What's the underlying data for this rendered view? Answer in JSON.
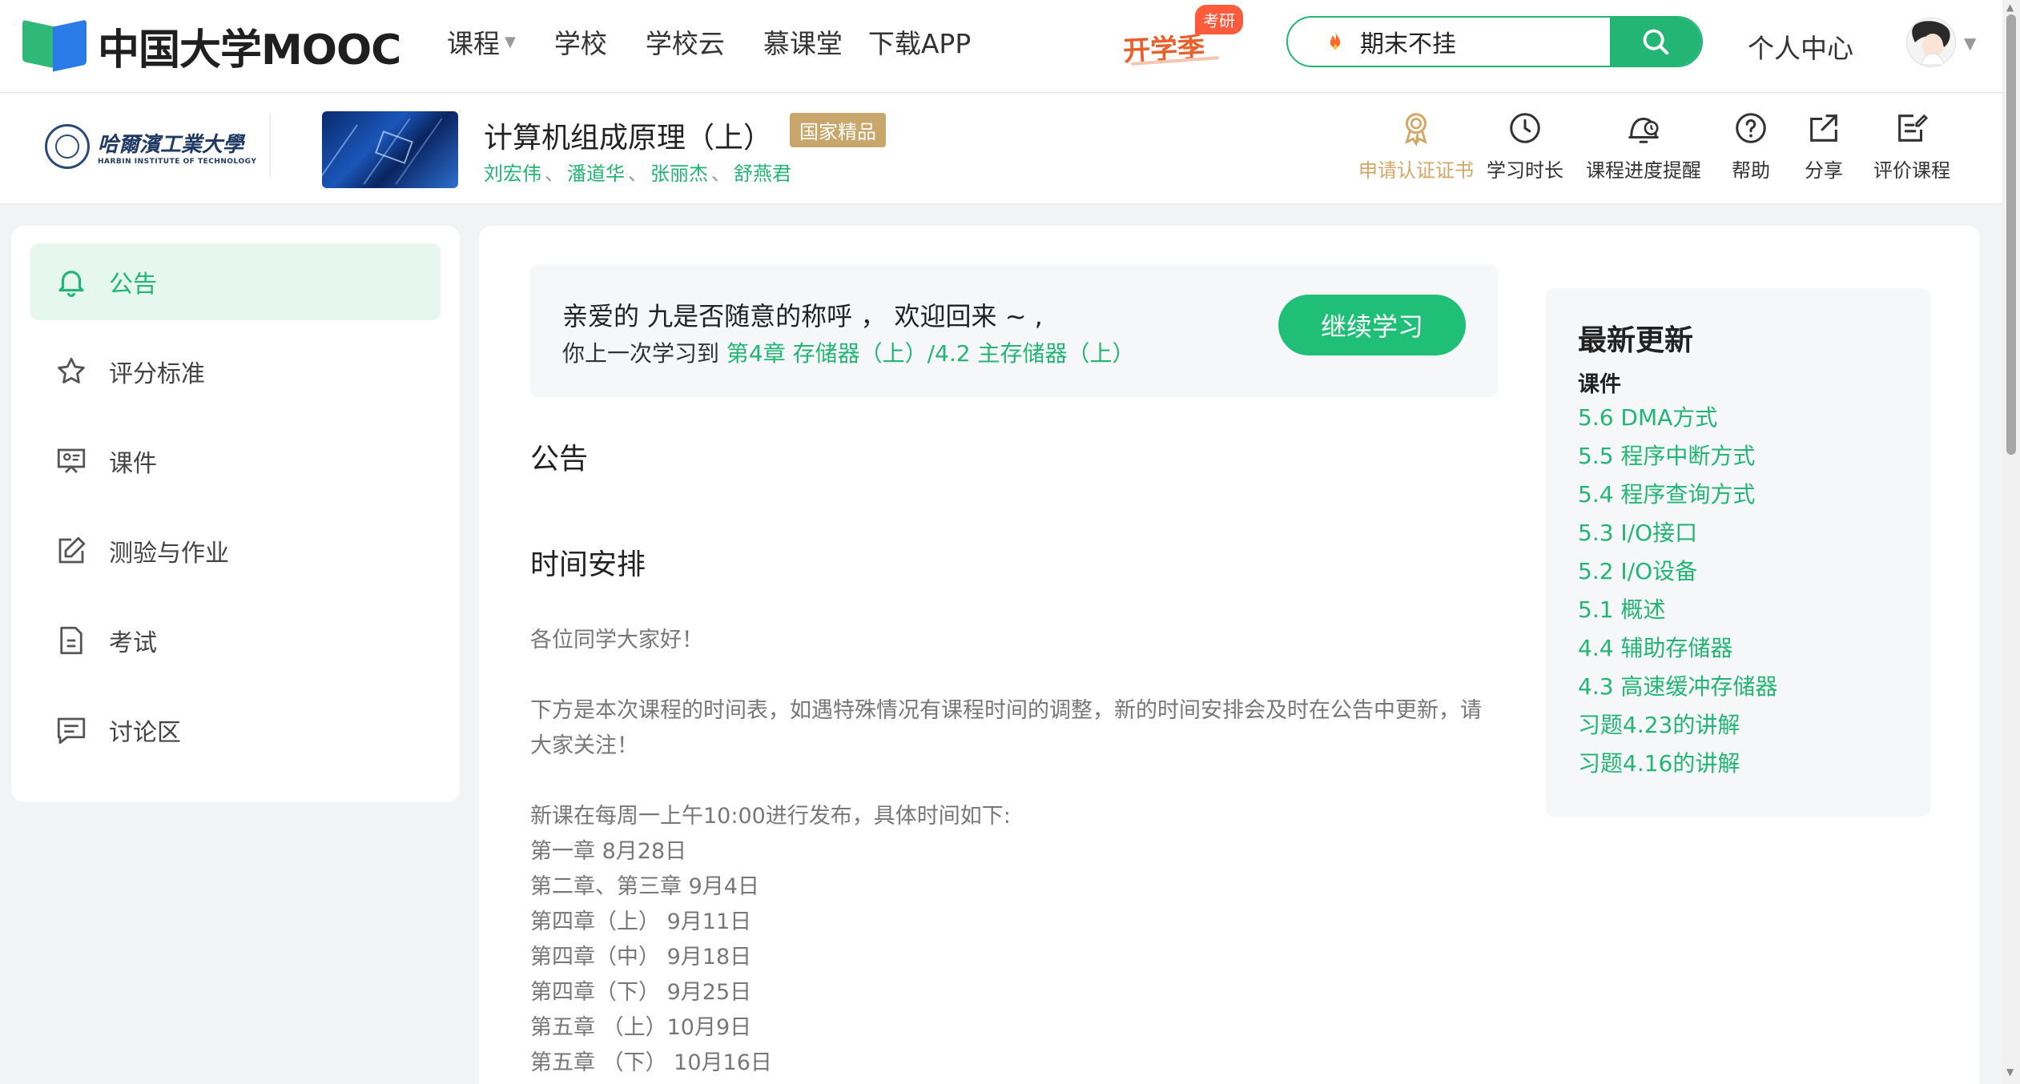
{
  "header": {
    "logo_text": "中国大学MOOC",
    "nav": [
      {
        "label": "课程",
        "has_caret": true
      },
      {
        "label": "学校"
      },
      {
        "label": "学校云"
      },
      {
        "label": "慕课堂"
      },
      {
        "label": "下载APP"
      }
    ],
    "promo": {
      "text": "开学季",
      "tag": "考研"
    },
    "search": {
      "query": "期末不挂"
    },
    "personal_center": "个人中心"
  },
  "course": {
    "school_cn": "哈爾濱工業大學",
    "school_en": "HARBIN INSTITUTE OF TECHNOLOGY",
    "title": "计算机组成原理（上）",
    "badge": "国家精品",
    "teachers": [
      "刘宏伟",
      "潘道华",
      "张丽杰",
      "舒燕君"
    ],
    "teacher_sep": "、",
    "tools": [
      {
        "label": "申请认证证书",
        "icon": "certificate-icon"
      },
      {
        "label": "学习时长",
        "icon": "clock-icon"
      },
      {
        "label": "课程进度提醒",
        "icon": "reminder-icon"
      },
      {
        "label": "帮助",
        "icon": "help-icon"
      },
      {
        "label": "分享",
        "icon": "share-icon"
      },
      {
        "label": "评价课程",
        "icon": "review-icon"
      }
    ]
  },
  "sidebar": {
    "items": [
      {
        "label": "公告",
        "icon": "bell-icon",
        "active": true
      },
      {
        "label": "评分标准",
        "icon": "star-icon"
      },
      {
        "label": "课件",
        "icon": "courseware-icon"
      },
      {
        "label": "测验与作业",
        "icon": "edit-icon"
      },
      {
        "label": "考试",
        "icon": "exam-icon"
      },
      {
        "label": "讨论区",
        "icon": "discussion-icon"
      }
    ]
  },
  "welcome": {
    "greeting": "亲爱的 九是否随意的称呼 ， 欢迎回来 ~ ,",
    "last_prefix": "你上一次学习到 ",
    "last_link": "第4章 存储器（上）/4.2 主存储器（上）",
    "continue_label": "继续学习"
  },
  "announcement": {
    "section_title": "公告",
    "title": "时间安排",
    "greeting": "各位同学大家好！",
    "intro": "下方是本次课程的时间表，如遇特殊情况有课程时间的调整，新的时间安排会及时在公告中更新，请大家关注！",
    "schedule_intro": "新课在每周一上午10:00进行发布，具体时间如下:",
    "schedule": [
      "第一章 8月28日",
      "第二章、第三章 9月4日",
      "第四章（上） 9月11日",
      "第四章（中） 9月18日",
      "第四章（下） 9月25日",
      "第五章 （上）10月9日",
      "第五章 （下） 10月16日"
    ]
  },
  "updates": {
    "title": "最新更新",
    "subtitle": "课件",
    "items": [
      "5.6 DMA方式",
      "5.5 程序中断方式",
      "5.4 程序查询方式",
      "5.3 I/O接口",
      "5.2 I/O设备",
      "5.1 概述",
      "4.4 辅助存储器",
      "4.3 高速缓冲存储器",
      "习题4.23的讲解",
      "习题4.16的讲解"
    ]
  },
  "colors": {
    "accent_green": "#22b573",
    "badge_gold": "#c9a66b",
    "promo_orange": "#e8612c"
  }
}
